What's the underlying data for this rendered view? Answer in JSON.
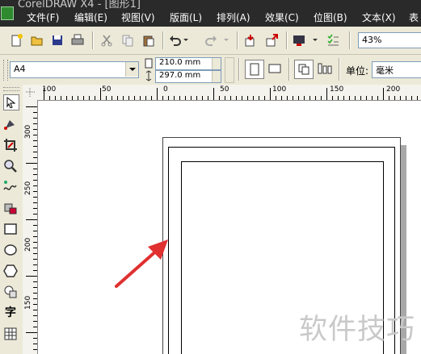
{
  "title_bar": {
    "text": "CorelDRAW X4 - [图形1]"
  },
  "menu": [
    "文件(F)",
    "编辑(E)",
    "视图(V)",
    "版面(L)",
    "排列(A)",
    "效果(C)",
    "位图(B)",
    "文本(X)",
    "表"
  ],
  "toolbar": {
    "zoom_value": "43%"
  },
  "property_bar": {
    "paper_size": "A4",
    "width": "210.0 mm",
    "height": "297.0 mm",
    "units_label": "单位:",
    "units_value": "毫米"
  },
  "ruler": {
    "h_labels": [
      "100",
      "50",
      "0",
      "50",
      "100",
      "150",
      "200"
    ],
    "v_labels": [
      "300",
      "250",
      "200",
      "150"
    ]
  },
  "toolbox": {
    "text_tool_glyph": "字"
  },
  "watermark": "软件技巧",
  "colors": {
    "menu_bg": "#2a2a2a",
    "toolbar_bg": "#ece9d8",
    "arrow": "#e03030"
  }
}
